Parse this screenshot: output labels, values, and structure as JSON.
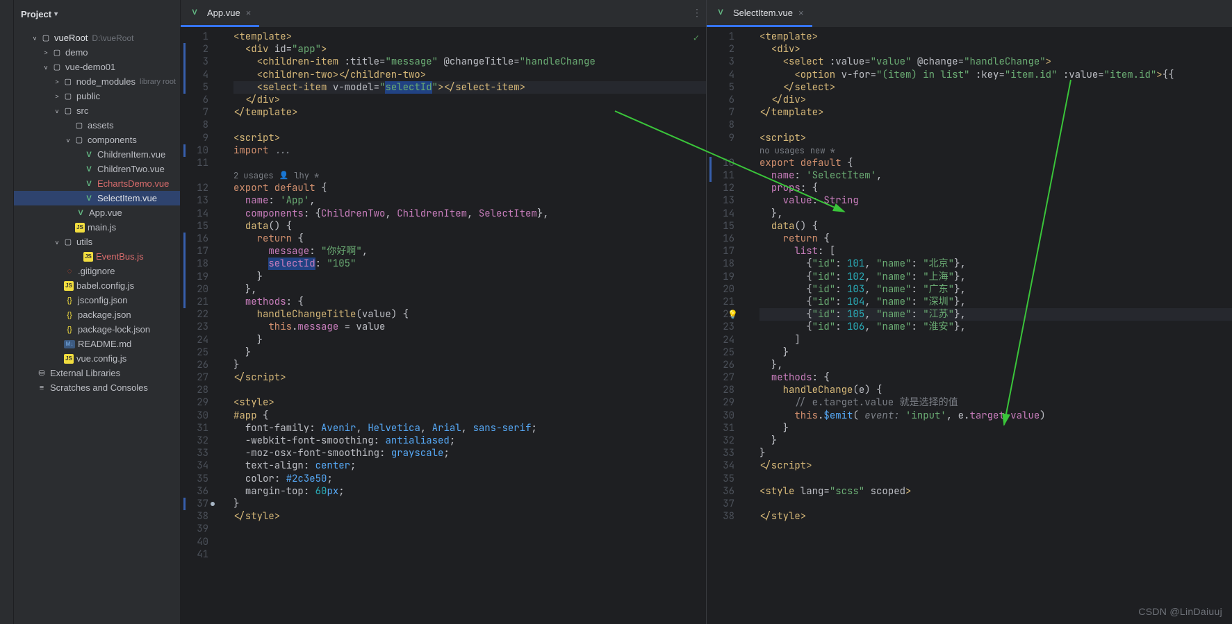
{
  "sidebar": {
    "header": "Project",
    "root": {
      "name": "vueRoot",
      "path": "D:\\vueRoot"
    },
    "tree": [
      {
        "kind": "folder",
        "indent": 40,
        "tw": ">",
        "label": "demo"
      },
      {
        "kind": "folder",
        "indent": 40,
        "tw": "v",
        "label": "vue-demo01"
      },
      {
        "kind": "folder",
        "indent": 56,
        "tw": ">",
        "label": "node_modules",
        "tag": "library root",
        "dim": true
      },
      {
        "kind": "folder",
        "indent": 56,
        "tw": ">",
        "label": "public"
      },
      {
        "kind": "folder",
        "indent": 56,
        "tw": "v",
        "label": "src"
      },
      {
        "kind": "folder",
        "indent": 72,
        "tw": "",
        "label": "assets"
      },
      {
        "kind": "folder",
        "indent": 72,
        "tw": "v",
        "label": "components"
      },
      {
        "kind": "vue",
        "indent": 100,
        "label": "ChildrenItem.vue"
      },
      {
        "kind": "vue",
        "indent": 100,
        "label": "ChildrenTwo.vue"
      },
      {
        "kind": "vue",
        "indent": 100,
        "label": "EchartsDemo.vue",
        "cls": "echarts"
      },
      {
        "kind": "vue",
        "indent": 100,
        "label": "SelectItem.vue",
        "active": true
      },
      {
        "kind": "vue",
        "indent": 88,
        "label": "App.vue"
      },
      {
        "kind": "js",
        "indent": 88,
        "label": "main.js"
      },
      {
        "kind": "folder",
        "indent": 56,
        "tw": "v",
        "label": "utils"
      },
      {
        "kind": "js",
        "indent": 100,
        "label": "EventBus.js",
        "cls": "echarts"
      },
      {
        "kind": "git",
        "indent": 72,
        "label": ".gitignore"
      },
      {
        "kind": "js",
        "indent": 72,
        "label": "babel.config.js"
      },
      {
        "kind": "json",
        "indent": 72,
        "label": "jsconfig.json"
      },
      {
        "kind": "json",
        "indent": 72,
        "label": "package.json"
      },
      {
        "kind": "json",
        "indent": 72,
        "label": "package-lock.json"
      },
      {
        "kind": "md",
        "indent": 72,
        "label": "README.md"
      },
      {
        "kind": "js",
        "indent": 72,
        "label": "vue.config.js"
      }
    ],
    "extras": [
      "External Libraries",
      "Scratches and Consoles"
    ]
  },
  "left": {
    "tab": "App.vue",
    "usages": {
      "count": "2 usages",
      "author": "lhy *"
    },
    "lineMarks": {
      "blue": [
        2,
        3,
        4,
        5,
        10,
        16,
        17,
        18,
        19,
        20,
        21,
        37
      ],
      "bp": [
        37
      ]
    },
    "lines": 41
  },
  "right": {
    "tab": "SelectItem.vue",
    "usages": {
      "left": "no usages",
      "right": "new *"
    },
    "lineMarks": {
      "blue": [
        10,
        11
      ],
      "bulb": [
        22
      ]
    },
    "lines": 38
  },
  "annotations": {
    "comment1": "// e.target.value 就是选择的值"
  },
  "watermark": "CSDN @LinDaiuuj"
}
